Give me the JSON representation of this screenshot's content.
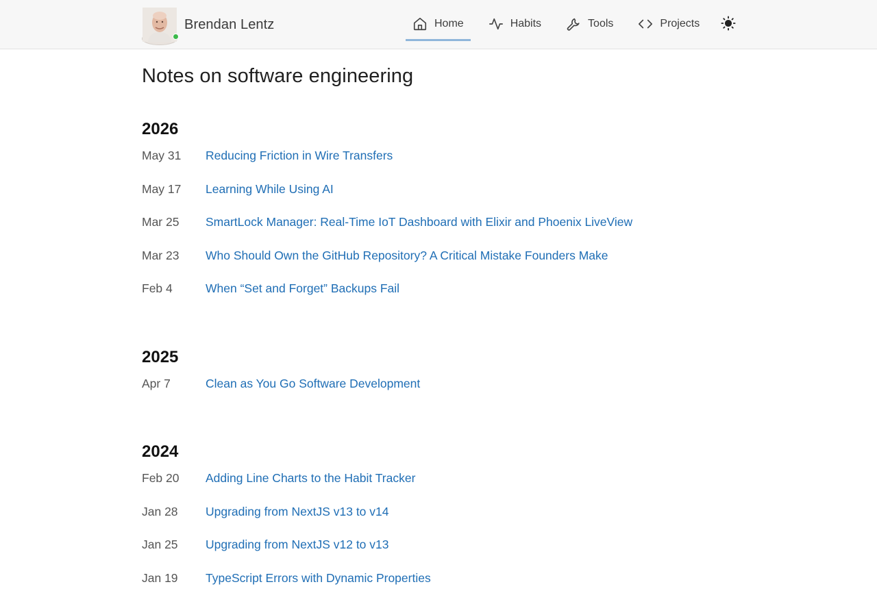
{
  "header": {
    "author_name": "Brendan Lentz",
    "status_color": "#3cb94a",
    "nav": [
      {
        "label": "Home",
        "icon": "home-icon",
        "active": true
      },
      {
        "label": "Habits",
        "icon": "activity-icon",
        "active": false
      },
      {
        "label": "Tools",
        "icon": "wrench-icon",
        "active": false
      },
      {
        "label": "Projects",
        "icon": "code-icon",
        "active": false
      }
    ],
    "theme_toggle_icon": "sun-icon"
  },
  "main": {
    "title": "Notes on software engineering",
    "years": [
      {
        "year": "2026",
        "posts": [
          {
            "date": "May 31",
            "title": "Reducing Friction in Wire Transfers"
          },
          {
            "date": "May 17",
            "title": "Learning While Using AI"
          },
          {
            "date": "Mar 25",
            "title": "SmartLock Manager: Real-Time IoT Dashboard with Elixir and Phoenix LiveView"
          },
          {
            "date": "Mar 23",
            "title": "Who Should Own the GitHub Repository? A Critical Mistake Founders Make"
          },
          {
            "date": "Feb 4",
            "title": "When “Set and Forget” Backups Fail"
          }
        ]
      },
      {
        "year": "2025",
        "posts": [
          {
            "date": "Apr 7",
            "title": "Clean as You Go Software Development"
          }
        ]
      },
      {
        "year": "2024",
        "posts": [
          {
            "date": "Feb 20",
            "title": "Adding Line Charts to the Habit Tracker"
          },
          {
            "date": "Jan 28",
            "title": "Upgrading from NextJS v13 to v14"
          },
          {
            "date": "Jan 25",
            "title": "Upgrading from NextJS v12 to v13"
          },
          {
            "date": "Jan 19",
            "title": "TypeScript Errors with Dynamic Properties"
          }
        ]
      }
    ]
  },
  "colors": {
    "link": "#1f6eb5",
    "active_underline": "#8fb6da"
  }
}
